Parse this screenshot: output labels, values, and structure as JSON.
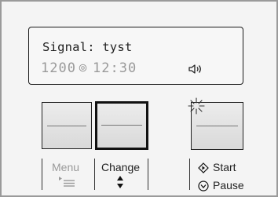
{
  "display": {
    "line1": "Signal: tyst",
    "rpm": "1200",
    "time": "12:30"
  },
  "buttons": {
    "menu_label": "Menu",
    "change_label": "Change",
    "start_label": "Start",
    "pause_label": "Pause"
  },
  "icons": {
    "rpm": "rpm-icon",
    "speaker": "speaker-icon",
    "menu": "menu-list-icon",
    "change": "up-down-arrows-icon",
    "start": "start-diamond-icon",
    "pause": "pause-icon",
    "sparkle": "sparkle-icon"
  },
  "colors": {
    "frame": "#9a9a9a",
    "display_text": "#222222",
    "segment_text": "#9a9a9a",
    "menu_disabled": "#999999"
  }
}
